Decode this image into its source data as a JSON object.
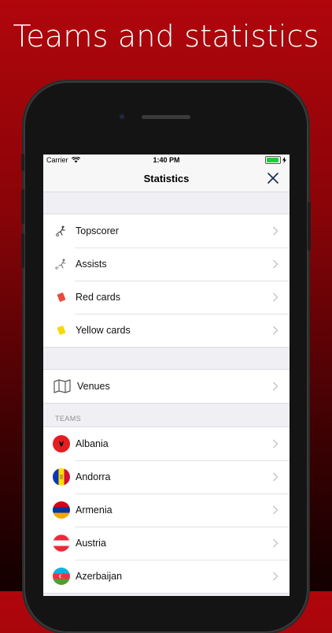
{
  "headline": "Teams and statistics",
  "status": {
    "carrier": "Carrier",
    "time": "1:40 PM"
  },
  "nav": {
    "title": "Statistics"
  },
  "stats_items": [
    {
      "label": "Topscorer",
      "icon": "soccer-kick-icon"
    },
    {
      "label": "Assists",
      "icon": "assist-pass-icon"
    },
    {
      "label": "Red cards",
      "icon": "red-card-icon",
      "color": "#e74c3c"
    },
    {
      "label": "Yellow cards",
      "icon": "yellow-card-icon",
      "color": "#f5d90a"
    }
  ],
  "venues": {
    "label": "Venues",
    "icon": "map-icon"
  },
  "teams": {
    "header": "TEAMS",
    "items": [
      {
        "label": "Albania",
        "flag": "albania-flag-icon"
      },
      {
        "label": "Andorra",
        "flag": "andorra-flag-icon"
      },
      {
        "label": "Armenia",
        "flag": "armenia-flag-icon"
      },
      {
        "label": "Austria",
        "flag": "austria-flag-icon"
      },
      {
        "label": "Azerbaijan",
        "flag": "azerbaijan-flag-icon"
      }
    ]
  },
  "colors": {
    "brand": "#b0060c",
    "chevron": "#c7c7cc",
    "nav_bg": "#f7f7f7",
    "list_bg": "#efeff4"
  }
}
